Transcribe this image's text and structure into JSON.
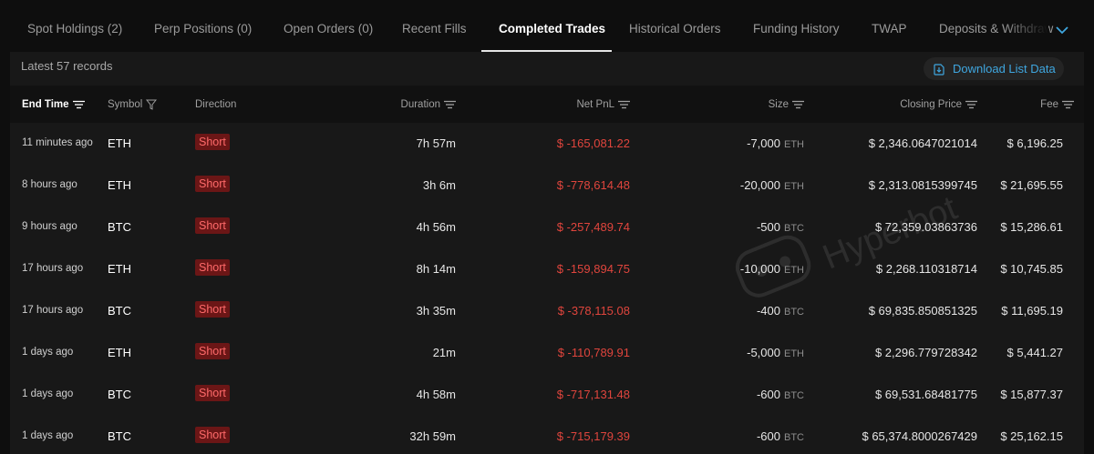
{
  "tabs": [
    {
      "label": "Spot Holdings (2)",
      "active": false
    },
    {
      "label": "Perp Positions (0)",
      "active": false
    },
    {
      "label": "Open Orders (0)",
      "active": false
    },
    {
      "label": "Recent Fills",
      "active": false
    },
    {
      "label": "Completed Trades",
      "active": true
    },
    {
      "label": "Historical Orders",
      "active": false
    },
    {
      "label": "Funding History",
      "active": false
    },
    {
      "label": "TWAP",
      "active": false
    },
    {
      "label": "Deposits & Withdraw",
      "active": false
    }
  ],
  "toolbar": {
    "records_label": "Latest 57 records",
    "download_label": "Download List Data"
  },
  "table": {
    "headers": {
      "end_time": "End Time",
      "symbol": "Symbol",
      "direction": "Direction",
      "duration": "Duration",
      "net_pnl": "Net PnL",
      "size": "Size",
      "closing_price": "Closing Price",
      "fee": "Fee"
    },
    "rows": [
      {
        "end_time": "11 minutes ago",
        "symbol": "ETH",
        "direction": "Short",
        "duration": "7h 57m",
        "net_pnl": "$ -165,081.22",
        "size": "-7,000",
        "size_unit": "ETH",
        "closing_price": "$ 2,346.0647021014",
        "fee": "$ 6,196.25"
      },
      {
        "end_time": "8 hours ago",
        "symbol": "ETH",
        "direction": "Short",
        "duration": "3h 6m",
        "net_pnl": "$ -778,614.48",
        "size": "-20,000",
        "size_unit": "ETH",
        "closing_price": "$ 2,313.0815399745",
        "fee": "$ 21,695.55"
      },
      {
        "end_time": "9 hours ago",
        "symbol": "BTC",
        "direction": "Short",
        "duration": "4h 56m",
        "net_pnl": "$ -257,489.74",
        "size": "-500",
        "size_unit": "BTC",
        "closing_price": "$ 72,359.03863736",
        "fee": "$ 15,286.61"
      },
      {
        "end_time": "17 hours ago",
        "symbol": "ETH",
        "direction": "Short",
        "duration": "8h 14m",
        "net_pnl": "$ -159,894.75",
        "size": "-10,000",
        "size_unit": "ETH",
        "closing_price": "$ 2,268.110318714",
        "fee": "$ 10,745.85"
      },
      {
        "end_time": "17 hours ago",
        "symbol": "BTC",
        "direction": "Short",
        "duration": "3h 35m",
        "net_pnl": "$ -378,115.08",
        "size": "-400",
        "size_unit": "BTC",
        "closing_price": "$ 69,835.850851325",
        "fee": "$ 11,695.19"
      },
      {
        "end_time": "1 days ago",
        "symbol": "ETH",
        "direction": "Short",
        "duration": "21m",
        "net_pnl": "$ -110,789.91",
        "size": "-5,000",
        "size_unit": "ETH",
        "closing_price": "$ 2,296.779728342",
        "fee": "$ 5,441.27"
      },
      {
        "end_time": "1 days ago",
        "symbol": "BTC",
        "direction": "Short",
        "duration": "4h 58m",
        "net_pnl": "$ -717,131.48",
        "size": "-600",
        "size_unit": "BTC",
        "closing_price": "$ 69,531.68481775",
        "fee": "$ 15,877.37"
      },
      {
        "end_time": "1 days ago",
        "symbol": "BTC",
        "direction": "Short",
        "duration": "32h 59m",
        "net_pnl": "$ -715,179.39",
        "size": "-600",
        "size_unit": "BTC",
        "closing_price": "$ 65,374.8000267429",
        "fee": "$ 25,162.15"
      }
    ]
  },
  "watermark": {
    "text": "Hyperbot"
  },
  "colors": {
    "accent": "#3fa7e0",
    "negative": "#e0453d",
    "short_badge_bg": "#6b1616",
    "short_badge_text": "#ff6a6a"
  }
}
